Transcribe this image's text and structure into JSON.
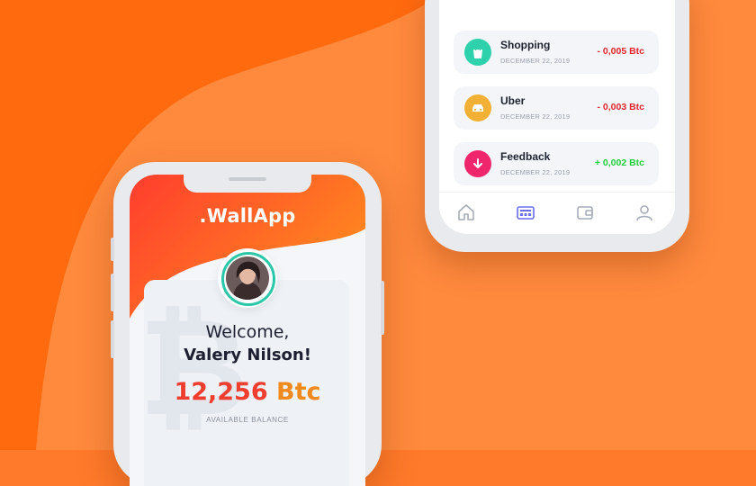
{
  "background": {
    "primary": "#ff6a0f",
    "secondary": "#ff8a3d"
  },
  "wallet_screen": {
    "app_title": ".WallApp",
    "avatar": "user-avatar",
    "welcome_text": "Welcome,",
    "user_name": "Valery Nilson!",
    "balance_value": "12,256",
    "balance_unit": "Btc",
    "balance_label": "AVAILABLE BALANCE",
    "watermark_icon": "bitcoin-icon",
    "colors": {
      "header_start": "#ff3d2e",
      "header_end": "#ff8a1e",
      "avatar_ring": "#2dc6a8"
    }
  },
  "transactions_screen": {
    "transactions": [
      {
        "name": "Shopping",
        "date": "DECEMBER 22, 2019",
        "amount": "- 0,005 Btc",
        "type": "negative",
        "icon": "shopping-bag-icon",
        "color": "#2fd1ad"
      },
      {
        "name": "Uber",
        "date": "DECEMBER 22, 2019",
        "amount": "- 0,003 Btc",
        "type": "negative",
        "icon": "car-icon",
        "color": "#f2b134"
      },
      {
        "name": "Feedback",
        "date": "DECEMBER 22, 2019",
        "amount": "+ 0,002 Btc",
        "type": "positive",
        "icon": "arrow-down-icon",
        "color": "#f0266c"
      }
    ],
    "tabs": [
      {
        "icon": "home-icon",
        "active": false
      },
      {
        "icon": "card-icon",
        "active": true
      },
      {
        "icon": "wallet-icon",
        "active": false
      },
      {
        "icon": "user-icon",
        "active": false
      }
    ],
    "colors": {
      "negative": "#e0262e",
      "positive": "#1ecf3a",
      "tab_active": "#6b6cf0",
      "tab_inactive": "#a6abb8"
    }
  }
}
